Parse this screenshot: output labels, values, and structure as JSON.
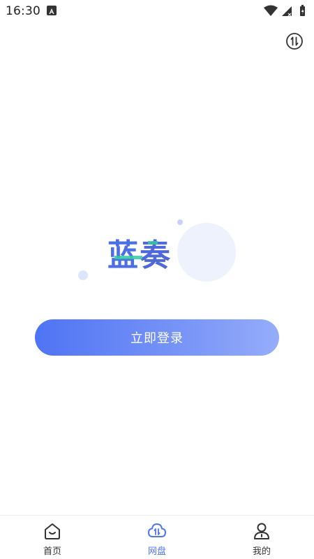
{
  "status_bar": {
    "time": "16:30",
    "notification_icon": "a-icon",
    "icons": [
      "wifi-icon",
      "signal-icon",
      "battery-icon"
    ]
  },
  "header": {
    "transfer_icon": "transfer-arrows-icon"
  },
  "logo": {
    "char1": "蓝",
    "char2": "奏"
  },
  "login_button": {
    "label": "立即登录"
  },
  "tab_bar": {
    "tabs": [
      {
        "label": "首页",
        "icon": "home-icon",
        "active": false
      },
      {
        "label": "网盘",
        "icon": "cloud-disk-icon",
        "active": true
      },
      {
        "label": "我的",
        "icon": "profile-icon",
        "active": false
      }
    ]
  },
  "colors": {
    "accent": "#4f74f4",
    "accent_light": "#96adfa",
    "text": "#333333",
    "logo_green": "#35c9a6"
  }
}
